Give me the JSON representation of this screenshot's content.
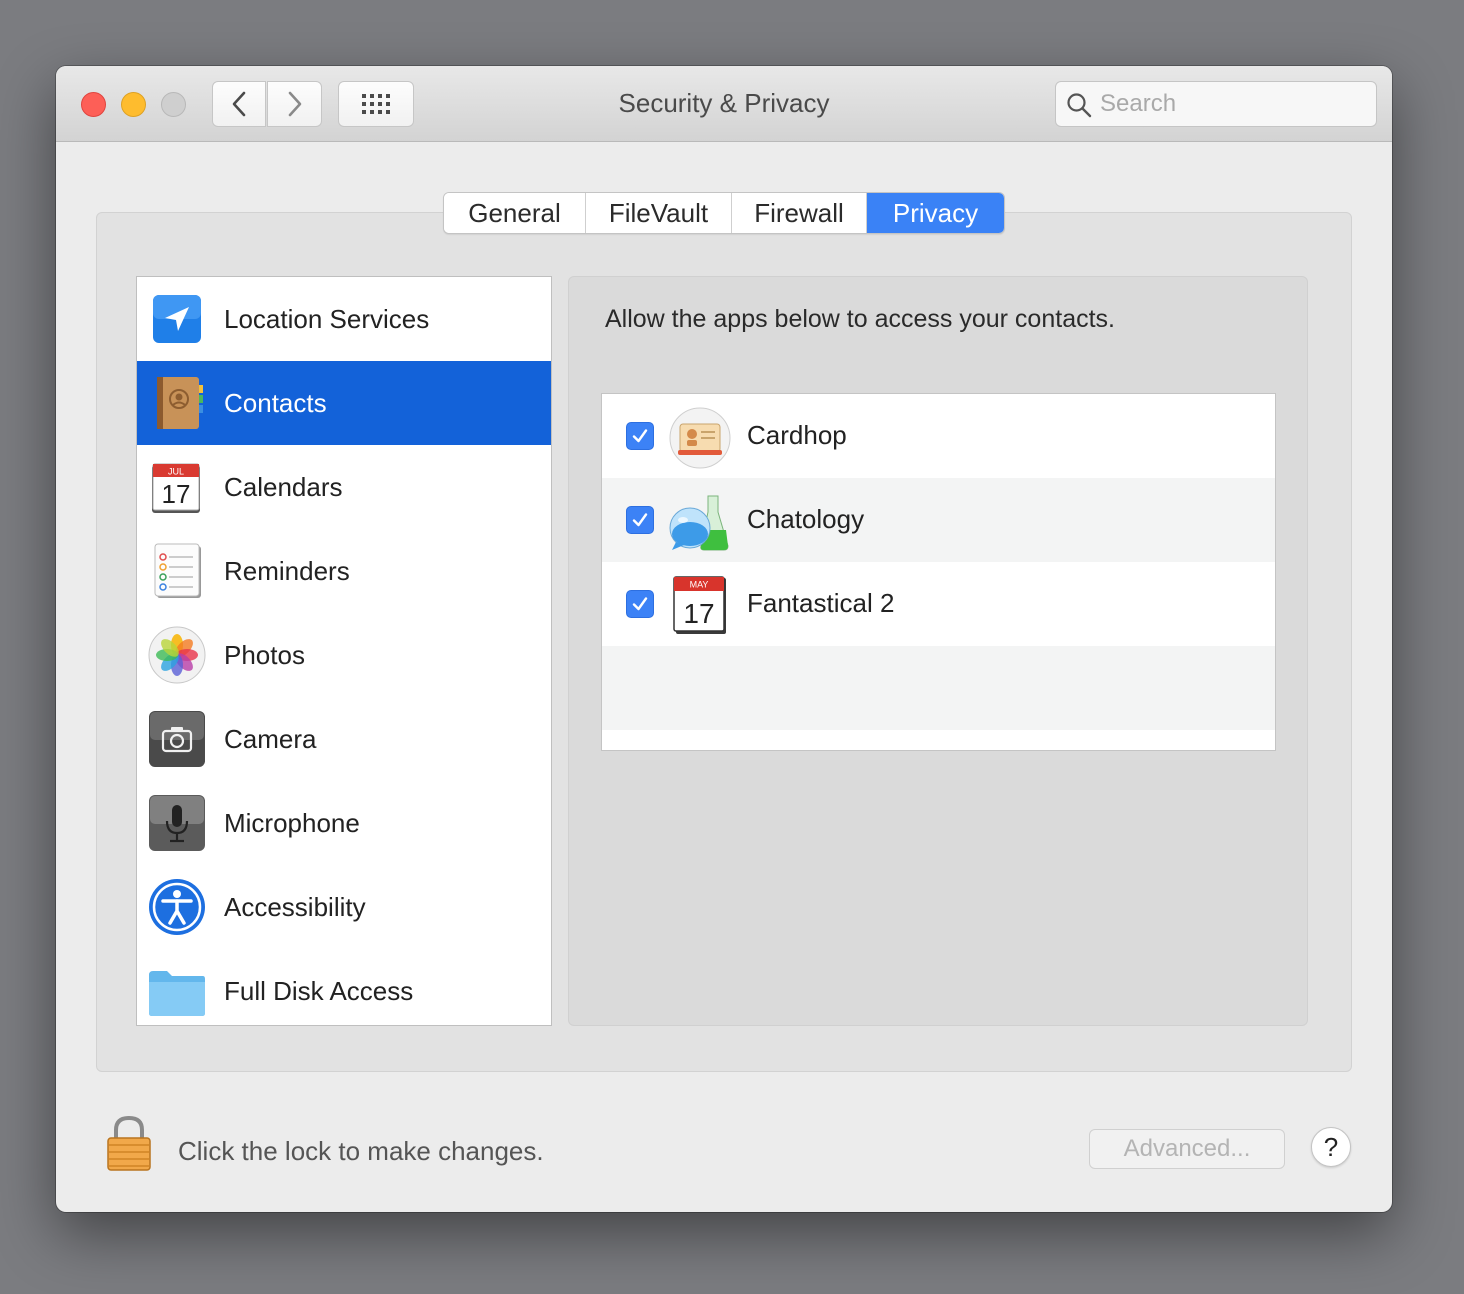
{
  "window": {
    "title": "Security & Privacy",
    "traffic_lights": {
      "close": "#fd5f57",
      "minimize": "#febc2e",
      "zoom": "#cfcfcf"
    }
  },
  "toolbar": {
    "back_icon": "chevron-left-icon",
    "forward_icon": "chevron-right-icon",
    "grid_icon": "show-all-grid-icon"
  },
  "search": {
    "placeholder": "Search",
    "value": ""
  },
  "tabs": [
    {
      "label": "General",
      "active": false
    },
    {
      "label": "FileVault",
      "active": false
    },
    {
      "label": "Firewall",
      "active": false
    },
    {
      "label": "Privacy",
      "active": true
    }
  ],
  "sidebar": {
    "items": [
      {
        "label": "Location Services",
        "icon": "location-arrow-icon",
        "selected": false
      },
      {
        "label": "Contacts",
        "icon": "contacts-book-icon",
        "selected": true
      },
      {
        "label": "Calendars",
        "icon": "calendar-icon",
        "selected": false,
        "icon_text": {
          "month": "JUL",
          "day": "17"
        }
      },
      {
        "label": "Reminders",
        "icon": "reminders-icon",
        "selected": false
      },
      {
        "label": "Photos",
        "icon": "photos-flower-icon",
        "selected": false
      },
      {
        "label": "Camera",
        "icon": "camera-icon",
        "selected": false
      },
      {
        "label": "Microphone",
        "icon": "microphone-icon",
        "selected": false
      },
      {
        "label": "Accessibility",
        "icon": "accessibility-icon",
        "selected": false
      },
      {
        "label": "Full Disk Access",
        "icon": "folder-icon",
        "selected": false
      }
    ]
  },
  "main": {
    "heading": "Allow the apps below to access your contacts.",
    "apps": [
      {
        "name": "Cardhop",
        "checked": true,
        "icon": "cardhop-icon"
      },
      {
        "name": "Chatology",
        "checked": true,
        "icon": "chatology-flask-icon"
      },
      {
        "name": "Fantastical 2",
        "checked": true,
        "icon": "fantastical-calendar-icon",
        "icon_text": {
          "month": "MAY",
          "day": "17"
        }
      }
    ]
  },
  "footer": {
    "lock_text": "Click the lock to make changes.",
    "advanced_label": "Advanced...",
    "help_label": "?"
  },
  "colors": {
    "accent": "#3a82f6",
    "selection": "#1362d9",
    "checkbox": "#3c82f6"
  }
}
